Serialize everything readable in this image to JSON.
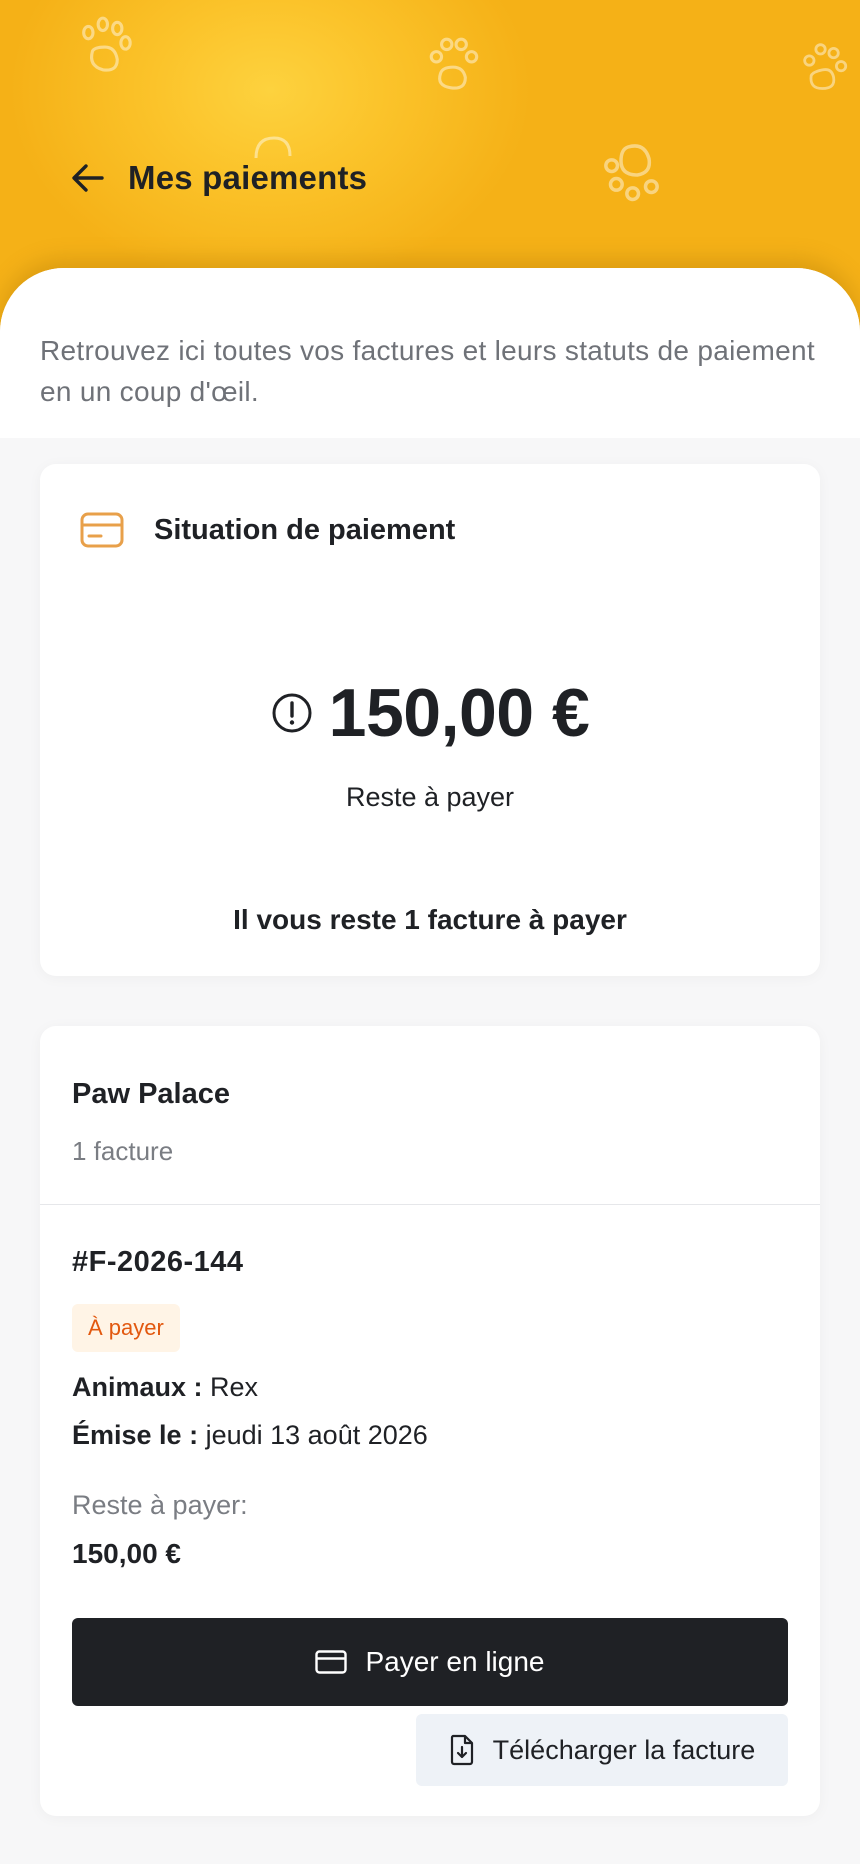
{
  "header": {
    "title": "Mes paiements",
    "back_icon": "arrow-left-icon"
  },
  "intro": "Retrouvez ici toutes vos factures et leurs statuts de paiement en un coup d'œil.",
  "summary": {
    "title": "Situation de paiement",
    "icon": "credit-card-icon",
    "alert_icon": "alert-circle-icon",
    "amount": "150,00 €",
    "amount_caption": "Reste à payer",
    "remaining_text": "Il vous reste 1 facture à payer"
  },
  "clinic": {
    "name": "Paw Palace",
    "invoice_count": "1 facture",
    "invoices": [
      {
        "number": "#F-2026-144",
        "status": "À payer",
        "animals_label": "Animaux :",
        "animals": "Rex",
        "issued_label": "Émise le :",
        "issued": "jeudi 13 août 2026",
        "due_label": "Reste à payer:",
        "due_amount": "150,00 €",
        "pay_label": "Payer en ligne",
        "download_label": "Télécharger la facture"
      }
    ]
  },
  "colors": {
    "header_yellow": "#f5b117",
    "accent_orange": "#e8a04a",
    "status_text": "#e2580f",
    "status_bg": "#fff4e6",
    "dark_button": "#1f2125"
  }
}
